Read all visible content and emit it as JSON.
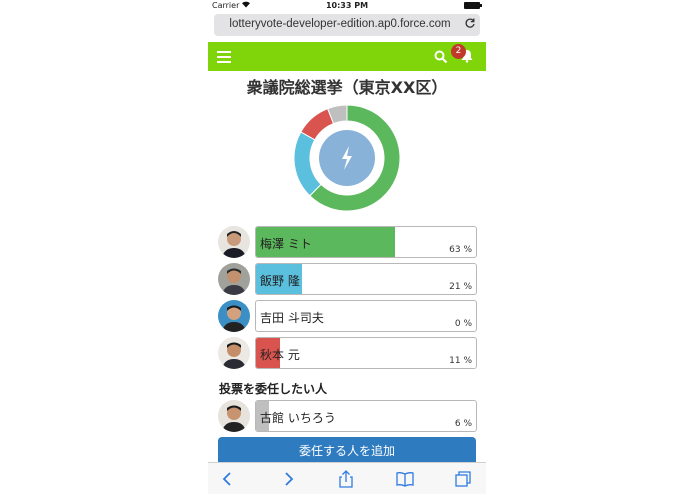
{
  "status": {
    "carrier": "Carrier",
    "time": "10:33 PM"
  },
  "browser": {
    "url": "lotteryvote-developer-edition.ap0.force.com"
  },
  "header": {
    "notification_count": "2",
    "accent": "#7fd40a"
  },
  "page": {
    "title": "衆議院総選挙（東京XX区）"
  },
  "chart_data": {
    "type": "pie",
    "categories": [
      "梅澤 ミト",
      "飯野 隆",
      "吉田 斗司夫",
      "秋本 元",
      "古館 いちろう"
    ],
    "values": [
      63,
      21,
      0,
      11,
      6
    ],
    "colors": [
      "#5cb85c",
      "#5bc0de",
      "#4a90d9",
      "#d9534f",
      "#bfbfbf"
    ]
  },
  "candidates": [
    {
      "name": "梅澤 ミト",
      "percent": "63 %",
      "value": 63,
      "color": "#5cb85c"
    },
    {
      "name": "飯野 隆",
      "percent": "21 %",
      "value": 21,
      "color": "#5bc0de"
    },
    {
      "name": "吉田 斗司夫",
      "percent": "0 %",
      "value": 0,
      "color": "#4a90d9"
    },
    {
      "name": "秋本 元",
      "percent": "11 %",
      "value": 11,
      "color": "#d9534f"
    }
  ],
  "delegate": {
    "section_title": "投票を委任したい人",
    "person": {
      "name": "古館 いちろう",
      "percent": "6 %",
      "value": 6,
      "color": "#bfbfbf"
    },
    "add_button": "委任する人を追加"
  }
}
